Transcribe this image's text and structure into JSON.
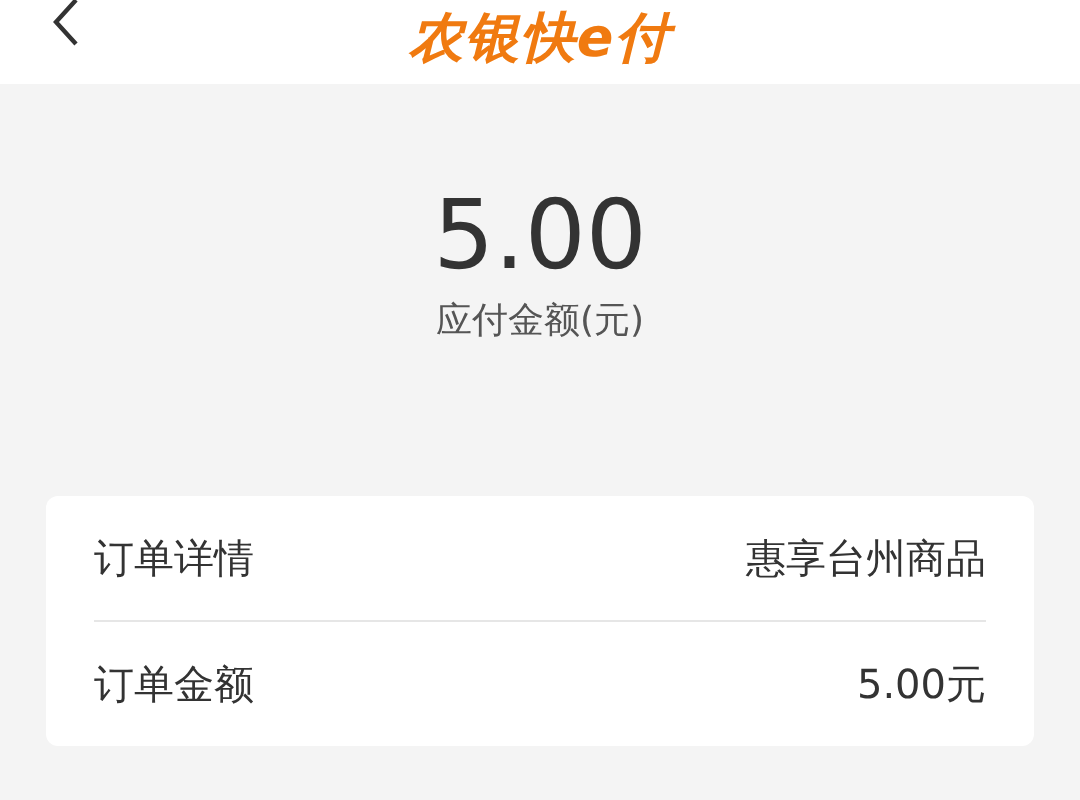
{
  "header": {
    "logo": "农银快e付"
  },
  "payment": {
    "amount": "5.00",
    "label": "应付金额(元)"
  },
  "order_rows": [
    {
      "label": "订单详情",
      "value": "惠享台州商品"
    },
    {
      "label": "订单金额",
      "value": "5.00元"
    }
  ]
}
